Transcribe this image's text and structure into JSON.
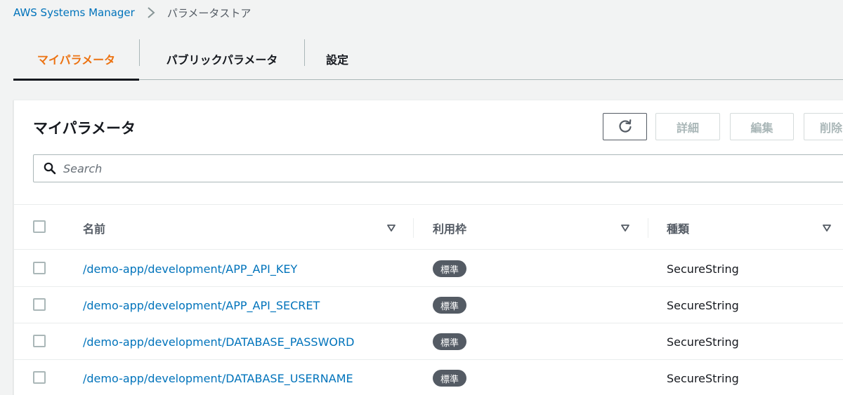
{
  "breadcrumb": {
    "root": "AWS Systems Manager",
    "current": "パラメータストア"
  },
  "tabs": [
    {
      "label": "マイパラメータ",
      "active": true
    },
    {
      "label": "パブリックパラメータ",
      "active": false
    },
    {
      "label": "設定",
      "active": false
    }
  ],
  "panel": {
    "title": "マイパラメータ",
    "buttons": {
      "refresh_icon": "refresh-icon",
      "details": "詳細",
      "edit": "編集",
      "delete": "削除"
    },
    "search": {
      "placeholder": "Search",
      "value": ""
    }
  },
  "table": {
    "columns": [
      "名前",
      "利用枠",
      "種類"
    ],
    "rows": [
      {
        "name": "/demo-app/development/APP_API_KEY",
        "tier": "標準",
        "type": "SecureString"
      },
      {
        "name": "/demo-app/development/APP_API_SECRET",
        "tier": "標準",
        "type": "SecureString"
      },
      {
        "name": "/demo-app/development/DATABASE_PASSWORD",
        "tier": "標準",
        "type": "SecureString"
      },
      {
        "name": "/demo-app/development/DATABASE_USERNAME",
        "tier": "標準",
        "type": "SecureString"
      }
    ]
  },
  "colors": {
    "link": "#0073bb",
    "active_tab": "#ec7211",
    "badge": "#545b64"
  }
}
